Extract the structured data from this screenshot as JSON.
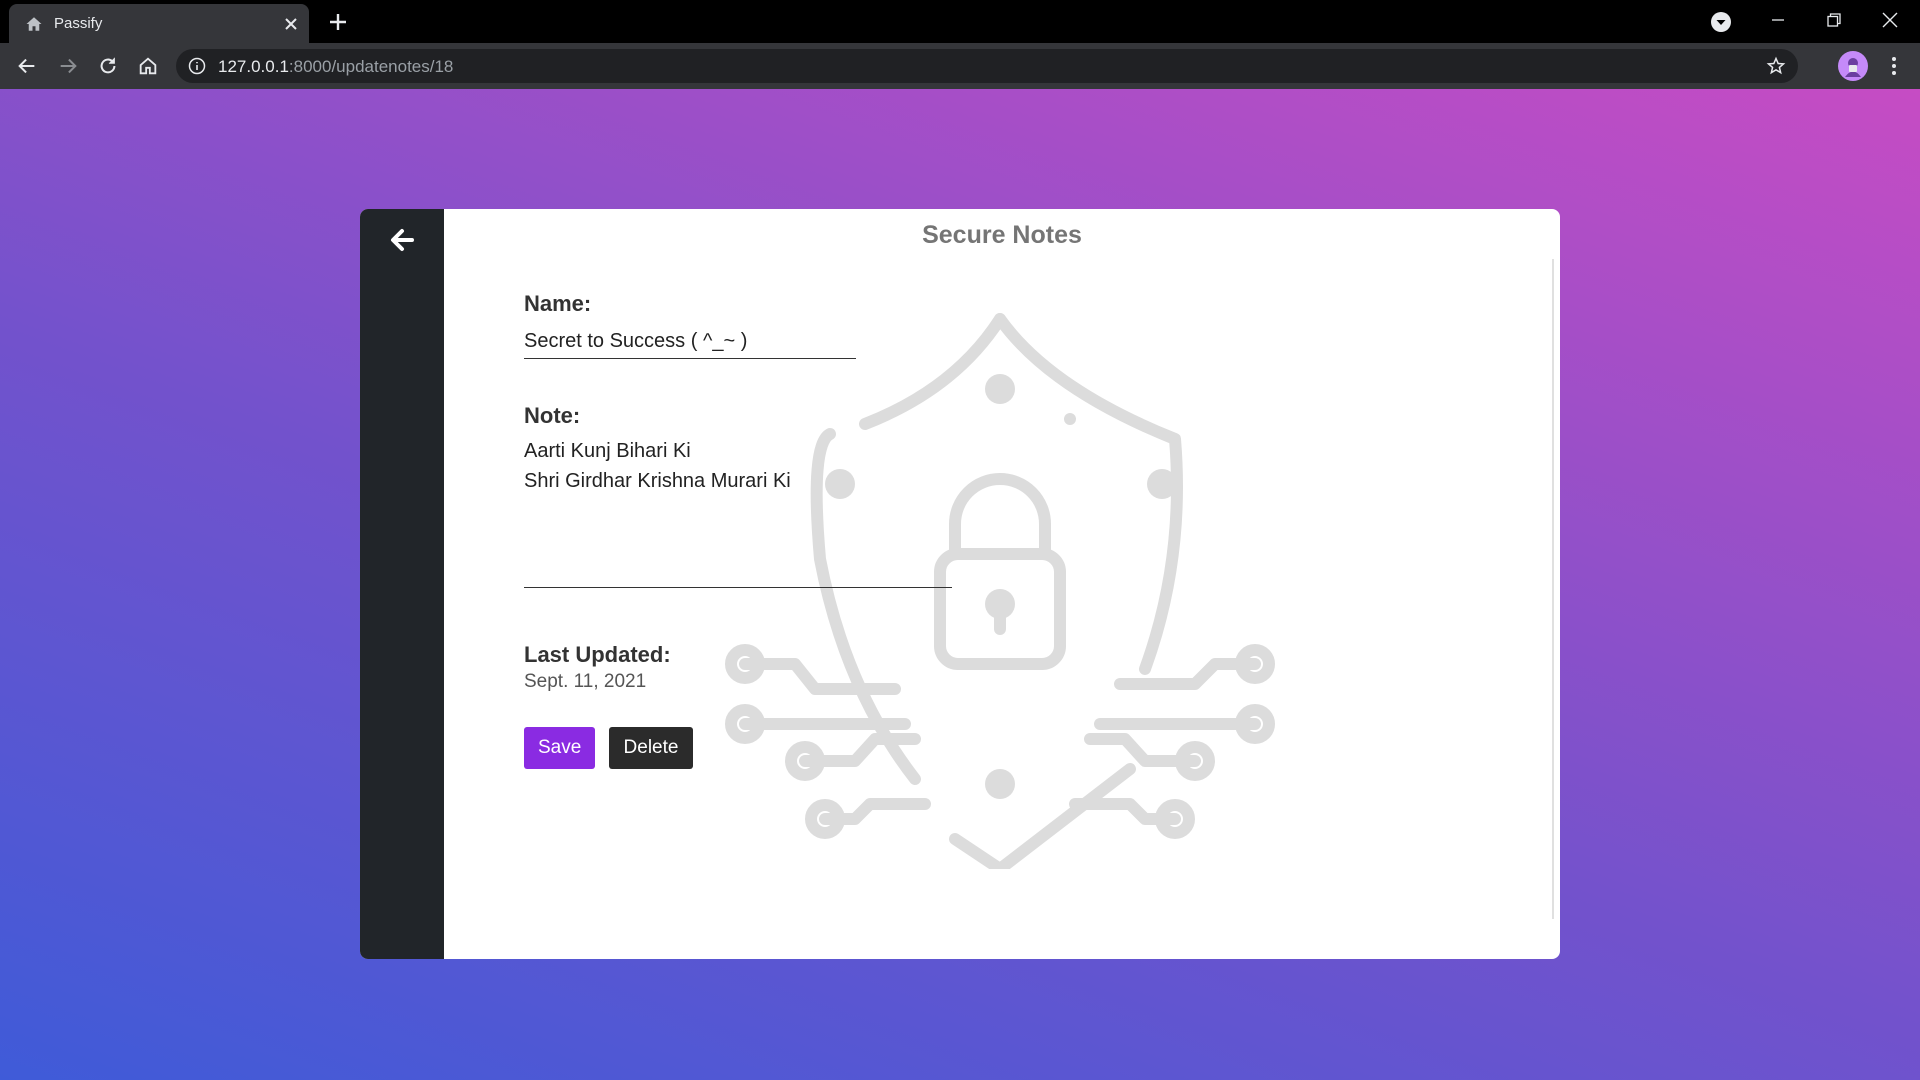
{
  "browser": {
    "tab_title": "Passify",
    "url_host": "127.0.0.1",
    "url_path": ":8000/updatenotes/18"
  },
  "page": {
    "title": "Secure Notes",
    "name_label": "Name:",
    "name_value": "Secret to Success ( ^_~ )",
    "note_label": "Note:",
    "note_value": "Aarti Kunj Bihari Ki\nShri Girdhar Krishna Murari Ki",
    "updated_label": "Last Updated:",
    "updated_value": "Sept. 11, 2021",
    "save_label": "Save",
    "delete_label": "Delete"
  },
  "icons": {
    "back": "arrow-left-icon",
    "watermark": "shield-lock-icon"
  },
  "colors": {
    "sidebar": "#212529",
    "save_button": "#8a2be2",
    "delete_button": "#2b2b2b",
    "background_start": "#3f5bd8",
    "background_end": "#c64cc4"
  }
}
